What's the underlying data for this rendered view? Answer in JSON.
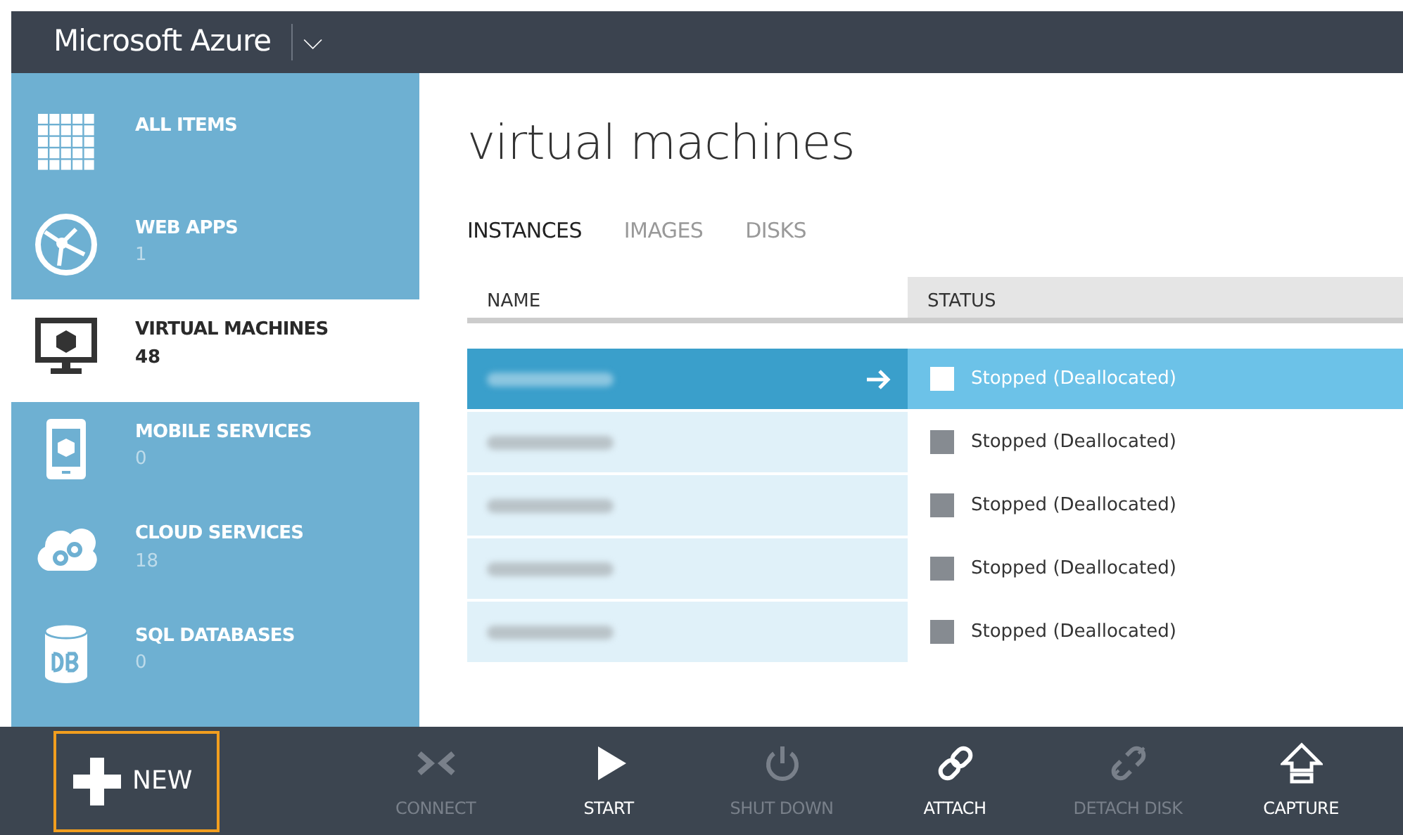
{
  "header": {
    "title": "Microsoft Azure",
    "menu_caret": "⌵"
  },
  "sidebar": {
    "items": [
      {
        "kind": "grid",
        "label": "ALL ITEMS",
        "selected": false
      },
      {
        "kind": "globe",
        "label": "WEB APPS",
        "count": "1",
        "selected": false
      },
      {
        "kind": "monitor",
        "label": "VIRTUAL MACHINES",
        "count": "48",
        "selected": true
      },
      {
        "kind": "phone",
        "label": "MOBILE SERVICES",
        "count": "0",
        "selected": false
      },
      {
        "kind": "cloud",
        "label": "CLOUD SERVICES",
        "count": "18",
        "selected": false
      },
      {
        "kind": "db",
        "label": "SQL DATABASES",
        "count": "0",
        "selected": false
      }
    ]
  },
  "page_title": "virtual machines",
  "tabs": [
    {
      "label": "INSTANCES",
      "selected": true
    },
    {
      "label": "IMAGES",
      "selected": false
    },
    {
      "label": "DISKS",
      "selected": false
    }
  ],
  "table": {
    "columns": [
      "NAME",
      "STATUS"
    ],
    "rows": [
      {
        "status": "Stopped (Deallocated)",
        "selected": true
      },
      {
        "status": "Stopped (Deallocated)",
        "selected": false
      },
      {
        "status": "Stopped (Deallocated)",
        "selected": false
      },
      {
        "status": "Stopped (Deallocated)",
        "selected": false
      },
      {
        "status": "Stopped (Deallocated)",
        "selected": false
      }
    ]
  },
  "command_bar": {
    "new_label": "NEW",
    "actions": [
      {
        "kind": "connect",
        "label": "CONNECT",
        "disabled": true
      },
      {
        "kind": "start",
        "label": "START",
        "disabled": false
      },
      {
        "kind": "shutdown",
        "label": "SHUT DOWN",
        "disabled": true
      },
      {
        "kind": "attach",
        "label": "ATTACH",
        "disabled": false
      },
      {
        "kind": "detach",
        "label": "DETACH DISK",
        "disabled": true
      },
      {
        "kind": "capture",
        "label": "CAPTURE",
        "disabled": false
      }
    ]
  }
}
